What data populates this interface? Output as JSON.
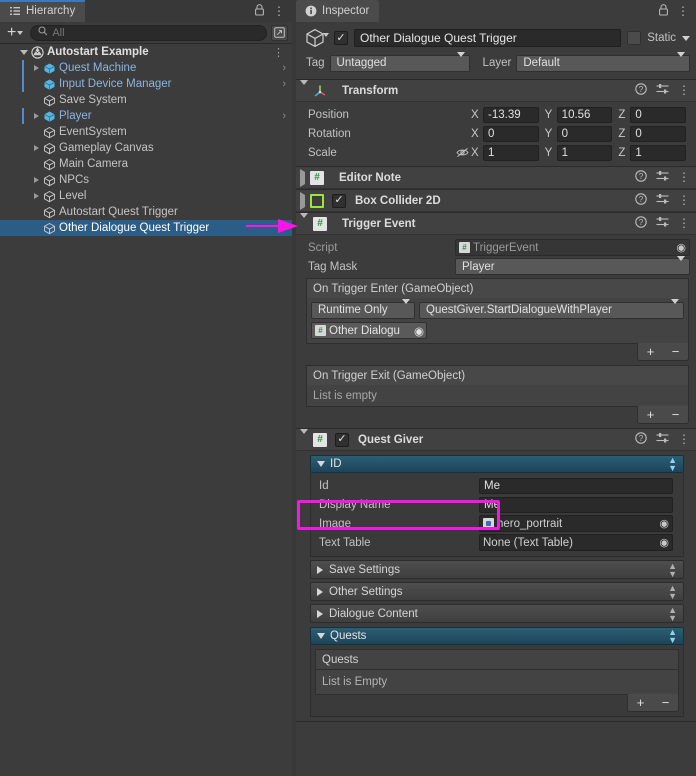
{
  "hierarchy": {
    "tab_label": "Hierarchy",
    "tab_icon": "hierarchy-icon",
    "lock_icon": "lock-icon",
    "menu_icon": "kebab-menu-icon",
    "add_button_label": "+",
    "search": {
      "placeholder": "All",
      "value": "",
      "icon": "search-icon"
    },
    "visibility_icon": "expand-window-icon",
    "root": {
      "label": "Autostart Example",
      "icon": "unity-scene-icon",
      "expanded": true
    },
    "items": [
      {
        "label": "Quest Machine",
        "icon": "prefab-cube-icon",
        "prefab": true,
        "expandable": true,
        "chevron": true
      },
      {
        "label": "Input Device Manager",
        "icon": "prefab-cube-icon",
        "prefab": true,
        "expandable": false,
        "chevron": true
      },
      {
        "label": "Save System",
        "icon": "gameobject-cube-icon",
        "prefab": false,
        "expandable": false,
        "chevron": false
      },
      {
        "label": "Player",
        "icon": "prefab-cube-icon",
        "prefab": true,
        "expandable": true,
        "chevron": true
      },
      {
        "label": "EventSystem",
        "icon": "gameobject-cube-icon",
        "prefab": false,
        "expandable": false,
        "chevron": false
      },
      {
        "label": "Gameplay Canvas",
        "icon": "gameobject-cube-icon",
        "prefab": false,
        "expandable": true,
        "chevron": false
      },
      {
        "label": "Main Camera",
        "icon": "gameobject-cube-icon",
        "prefab": false,
        "expandable": false,
        "chevron": false
      },
      {
        "label": "NPCs",
        "icon": "gameobject-cube-icon",
        "prefab": false,
        "expandable": true,
        "chevron": false
      },
      {
        "label": "Level",
        "icon": "gameobject-cube-icon",
        "prefab": false,
        "expandable": true,
        "chevron": false
      },
      {
        "label": "Autostart Quest Trigger",
        "icon": "gameobject-cube-icon",
        "prefab": false,
        "expandable": false,
        "chevron": false
      },
      {
        "label": "Other Dialogue Quest Trigger",
        "icon": "gameobject-cube-icon",
        "prefab": false,
        "expandable": false,
        "chevron": false,
        "selected": true
      }
    ]
  },
  "annotations": {
    "arrow_color": "#f715e8",
    "arrow_target": "Other Dialogue Quest Trigger",
    "box_color": "#f715e8",
    "box_target": "Id"
  },
  "inspector": {
    "tab_label": "Inspector",
    "tab_icon": "info-icon",
    "lock_icon": "lock-icon",
    "menu_icon": "kebab-menu-icon",
    "gameobject": {
      "icon": "gameobject-cube-icon",
      "enabled": true,
      "name": "Other Dialogue Quest Trigger",
      "static_label": "Static",
      "static_checked": false,
      "tag_label": "Tag",
      "tag_value": "Untagged",
      "layer_label": "Layer",
      "layer_value": "Default"
    },
    "transform": {
      "title": "Transform",
      "icon": "transform-axis-icon",
      "expanded": true,
      "help_icon": "help-icon",
      "preset_icon": "preset-icon",
      "menu_icon": "kebab-menu-icon",
      "rows": [
        {
          "label": "Position",
          "x": "-13.39",
          "y": "10.56",
          "z": "0",
          "eye": false
        },
        {
          "label": "Rotation",
          "x": "0",
          "y": "0",
          "z": "0",
          "eye": false
        },
        {
          "label": "Scale",
          "x": "1",
          "y": "1",
          "z": "1",
          "eye": true
        }
      ],
      "axis_labels": [
        "X",
        "Y",
        "Z"
      ]
    },
    "editor_note": {
      "title": "Editor Note",
      "icon": "script-icon",
      "expanded": false
    },
    "box_collider": {
      "title": "Box Collider 2D",
      "icon": "collider2d-icon",
      "enabled": true,
      "expanded": false
    },
    "trigger_event": {
      "title": "Trigger Event",
      "icon": "script-icon",
      "expanded": true,
      "script_label": "Script",
      "script_value": "TriggerEvent",
      "tag_mask_label": "Tag Mask",
      "tag_mask_value": "Player",
      "on_enter": {
        "header": "On Trigger Enter (GameObject)",
        "call_mode": "Runtime Only",
        "function": "QuestGiver.StartDialogueWithPlayer",
        "target_object": "Other Dialogu",
        "add_label": "+",
        "remove_label": "−"
      },
      "on_exit": {
        "header": "On Trigger Exit (GameObject)",
        "empty_text": "List is empty",
        "add_label": "+",
        "remove_label": "−"
      }
    },
    "quest_giver": {
      "title": "Quest Giver",
      "icon": "script-icon",
      "enabled": true,
      "expanded": true,
      "id_section": {
        "label": "ID",
        "expanded": true,
        "rows": [
          {
            "label": "Id",
            "value": "Me",
            "type": "text"
          },
          {
            "label": "Display Name",
            "value": "Me",
            "type": "text"
          },
          {
            "label": "Image",
            "value": "hero_portrait",
            "type": "object",
            "icon": "sprite-asset-icon"
          },
          {
            "label": "Text Table",
            "value": "None (Text Table)",
            "type": "object",
            "icon": "none-asset-icon"
          }
        ]
      },
      "collapsed_sections": [
        {
          "label": "Save Settings",
          "expanded": false
        },
        {
          "label": "Other Settings",
          "expanded": false
        },
        {
          "label": "Dialogue Content",
          "expanded": false
        }
      ],
      "quests_section": {
        "label": "Quests",
        "expanded": true,
        "list_header": "Quests",
        "empty_text": "List is Empty",
        "add_label": "+",
        "remove_label": "−"
      }
    }
  }
}
